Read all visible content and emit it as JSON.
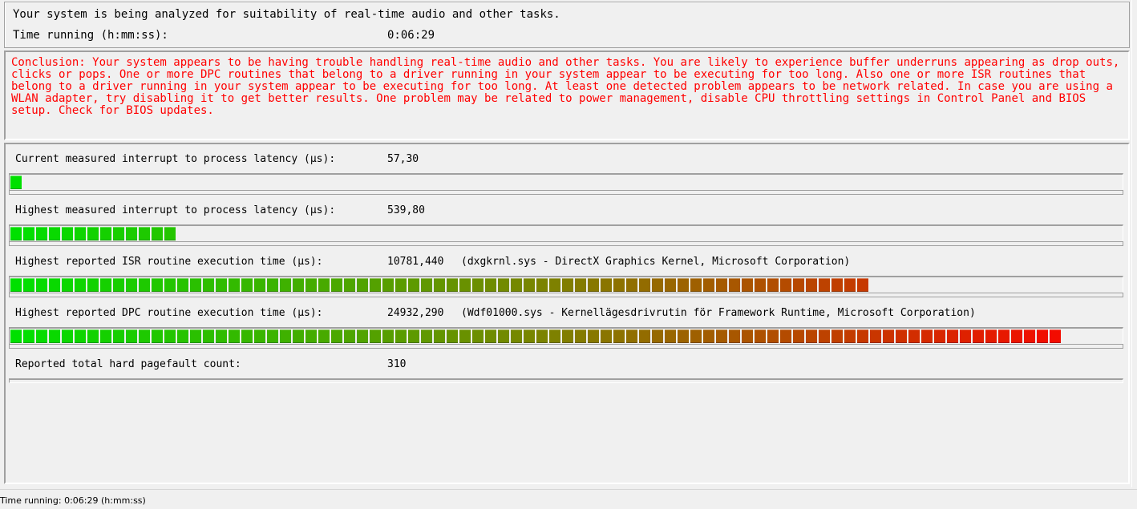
{
  "header": {
    "status_text": "Your system is being analyzed for suitability of real-time audio and other tasks.",
    "time_label": "Time running (h:mm:ss):",
    "time_value": "0:06:29"
  },
  "conclusion": {
    "text": "Conclusion: Your system appears to be having trouble handling real-time audio and other tasks. You are likely to experience buffer underruns appearing as drop outs, clicks or pops. One or more DPC routines that belong to a driver running in your system appear to be executing for too long. Also one or more ISR routines that belong to a driver running in your system appear to be executing for too long. At least one detected problem appears to be network related. In case you are using a WLAN adapter, try disabling it to get better results. One problem may be related to power management, disable CPU throttling settings in Control Panel and BIOS setup. Check for BIOS updates.",
    "color": "#ff0000"
  },
  "metrics": [
    {
      "label": "Current measured interrupt to process latency (µs):",
      "value": "57,30",
      "detail": "",
      "bar_fraction": 0.011
    },
    {
      "label": "Highest measured interrupt to process latency (µs):",
      "value": "539,80",
      "detail": "",
      "bar_fraction": 0.149
    },
    {
      "label": "Highest reported ISR routine execution time (µs):",
      "value": "10781,440",
      "detail": "(dxgkrnl.sys - DirectX Graphics Kernel, Microsoft Corporation)",
      "bar_fraction": 0.782
    },
    {
      "label": "Highest reported DPC routine execution time (µs):",
      "value": "24932,290",
      "detail": "(Wdf01000.sys - Kernellägesdrivrutin för Framework Runtime, Microsoft Corporation)",
      "bar_fraction": 0.955
    },
    {
      "label": "Reported total hard pagefault count:",
      "value": "310",
      "detail": ""
    }
  ],
  "colors": {
    "bar_low": "#00e000",
    "bar_high": "#ff0000"
  },
  "status_bar": {
    "text": "Time running: 0:06:29  (h:mm:ss)"
  }
}
